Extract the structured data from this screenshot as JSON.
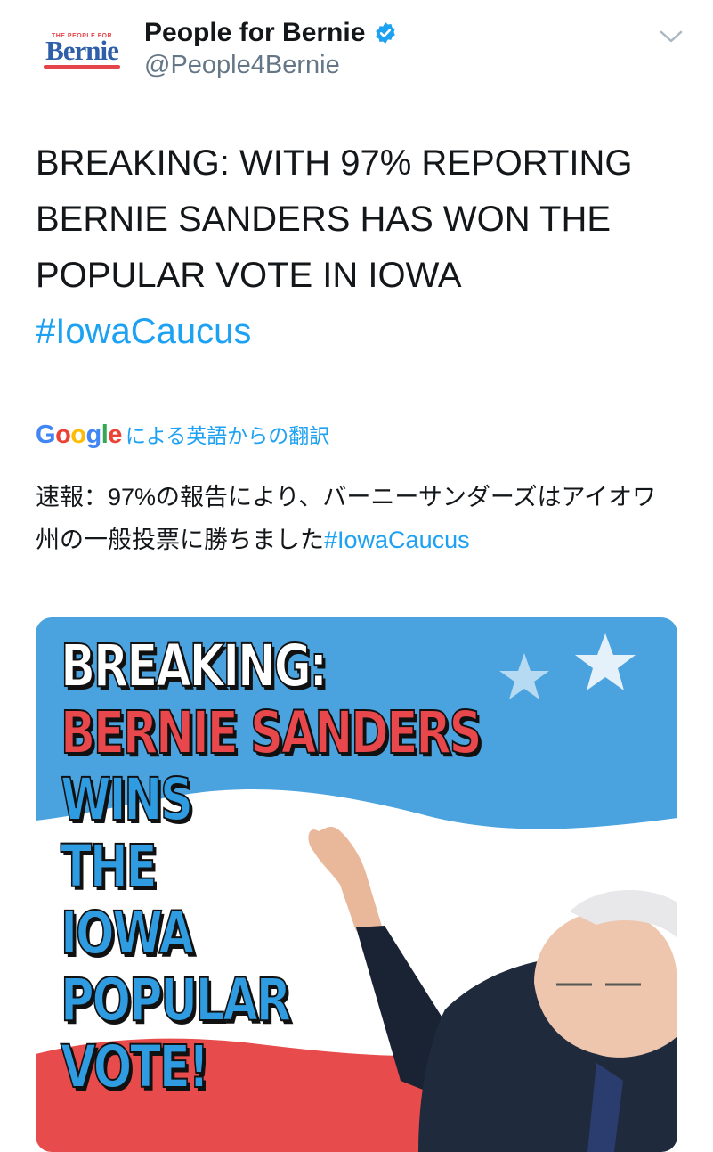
{
  "header": {
    "avatar_small_text": "THE PEOPLE FOR",
    "avatar_logo_text": "Bernie",
    "display_name": "People for Bernie",
    "handle": "@People4Bernie",
    "verified_icon": "verified-badge-icon",
    "menu_icon": "chevron-down-icon"
  },
  "tweet": {
    "text_line1": "BREAKING: WITH 97% REPORTING",
    "text_line2": "BERNIE SANDERS HAS WON THE",
    "text_line3": "POPULAR VOTE IN IOWA",
    "hashtag": "#IowaCaucus"
  },
  "translation": {
    "google_logo": "Google",
    "label_suffix": "による英語からの翻訳",
    "text": "速報：97%の報告により、バーニーサンダーズはアイオワ州の一般投票に勝ちました",
    "hashtag": "#IowaCaucus"
  },
  "media": {
    "line1": "BREAKING:",
    "line2": "BERNIE SANDERS",
    "line3": "WINS",
    "line4": "THE",
    "line5": "IOWA",
    "line6": "POPULAR",
    "line7": "VOTE!",
    "colors": {
      "sky": "#4aa3df",
      "red": "#e84b4b",
      "white": "#ffffff"
    }
  }
}
